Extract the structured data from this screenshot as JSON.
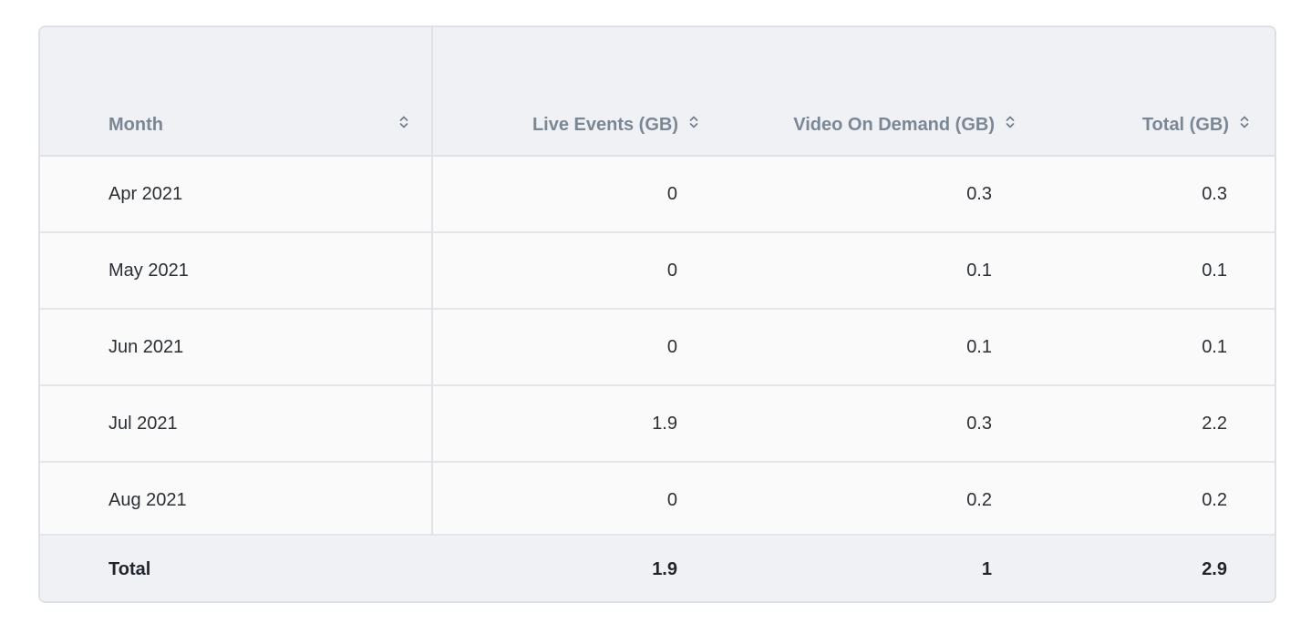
{
  "table": {
    "columns": [
      {
        "label": "Month"
      },
      {
        "label": "Live Events (GB)"
      },
      {
        "label": "Video On Demand (GB)"
      },
      {
        "label": "Total (GB)"
      }
    ],
    "rows": [
      {
        "month": "Apr 2021",
        "live": "0",
        "vod": "0.3",
        "total": "0.3"
      },
      {
        "month": "May 2021",
        "live": "0",
        "vod": "0.1",
        "total": "0.1"
      },
      {
        "month": "Jun 2021",
        "live": "0",
        "vod": "0.1",
        "total": "0.1"
      },
      {
        "month": "Jul 2021",
        "live": "1.9",
        "vod": "0.3",
        "total": "2.2"
      },
      {
        "month": "Aug 2021",
        "live": "0",
        "vod": "0.2",
        "total": "0.2"
      }
    ],
    "footer": {
      "label": "Total",
      "live": "1.9",
      "vod": "1",
      "total": "2.9"
    }
  },
  "icons": {
    "sort": "sort-icon"
  },
  "colors": {
    "header_bg": "#eff1f5",
    "header_text": "#7b8794",
    "row_bg": "#fafafa",
    "border": "#dfe3e8",
    "text": "#2a2f35"
  }
}
